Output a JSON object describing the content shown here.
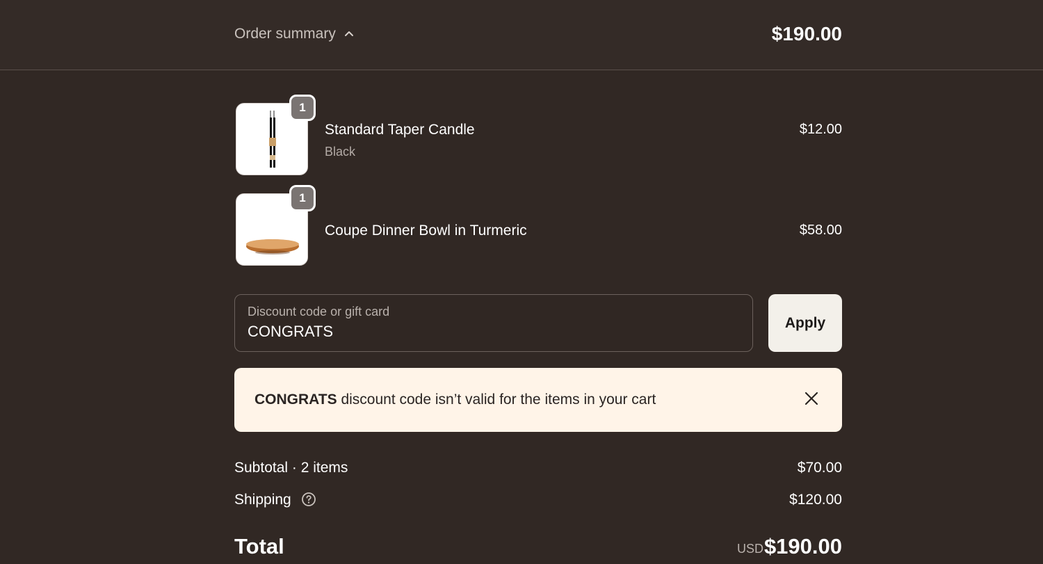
{
  "header": {
    "toggle_label": "Order summary",
    "total": "$190.00"
  },
  "items": [
    {
      "name": "Standard Taper Candle",
      "variant": "Black",
      "price": "$12.00",
      "quantity": "1",
      "image": "taper-candle-image"
    },
    {
      "name": "Coupe Dinner Bowl in Turmeric",
      "variant": "",
      "price": "$58.00",
      "quantity": "1",
      "image": "dinner-bowl-image"
    }
  ],
  "discount": {
    "label": "Discount code or gift card",
    "value": "CONGRATS",
    "apply_label": "Apply"
  },
  "alert": {
    "code": "CONGRATS",
    "message": " discount code isn’t valid for the items in your cart"
  },
  "summary": {
    "subtotal_label": "Subtotal · 2 items",
    "subtotal_value": "$70.00",
    "shipping_label": "Shipping",
    "shipping_value": "$120.00",
    "total_label": "Total",
    "currency": "USD",
    "total_value": "$190.00"
  },
  "colors": {
    "background": "#312824",
    "alert_background": "#fff4e8",
    "apply_button": "#f3f0ea"
  }
}
